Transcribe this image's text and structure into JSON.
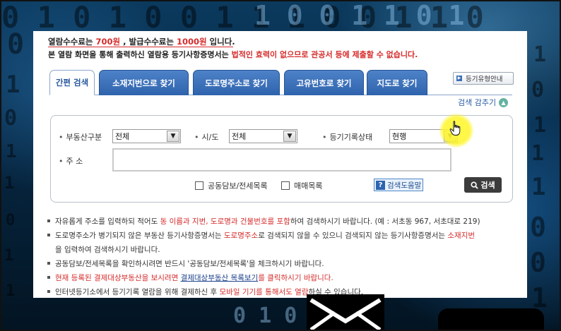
{
  "notice": {
    "fee_prefix": "열람수수료는 ",
    "fee_view": "700원",
    "fee_mid": " , 발급수수료는 ",
    "fee_issue": "1000원",
    "fee_suffix": " 입니다.",
    "legal_prefix": "본 열람 화면을 통해 출력하신 열람용 등기사항증명서는 ",
    "legal_red": "법적인 효력이 없으므로 관공서 등에 제출할 수 없습니다."
  },
  "tabs": [
    {
      "label": "간편 검색",
      "active": true
    },
    {
      "label": "소재지번으로 찾기",
      "active": false
    },
    {
      "label": "도로명주소로 찾기",
      "active": false
    },
    {
      "label": "고유번호로 찾기",
      "active": false
    },
    {
      "label": "지도로 찾기",
      "active": false
    }
  ],
  "type_guide_label": "등기유형안내",
  "hide_search_label": "검색 감추기",
  "search": {
    "property_type_label": "부동산구분",
    "property_type_value": "전체",
    "region_label": "시/도",
    "region_value": "전체",
    "record_status_label": "등기기록상태",
    "record_status_value": "현행",
    "address_label": "주 소",
    "address_value": "",
    "checkbox_mortgage": "공동담보/전세목록",
    "checkbox_sale": "매매목록",
    "help_label": "검색도움말",
    "search_label": "검색"
  },
  "bullets": {
    "b1_a": "자유롭게 주소를 입력하되 적어도 ",
    "b1_red": "동 이름과 지번, 도로명과 건물번호를 포함",
    "b1_b": "하여 검색하시기 바랍니다. (예 : 서초동 967, 서초대로 219)",
    "b2_a": "도로명주소가 병기되지 않은 부동산 등기사항증명서는 ",
    "b2_red1": "도로명주소",
    "b2_b": "로 검색되지 않을 수 있으니 검색되지 않는 등기사항증명서는 ",
    "b2_red2": "소재지번",
    "b2_cont": "을 입력하여 검색하시기 바랍니다.",
    "b3": "공동담보/전세목록을 확인하시려면 반드시 '공동담보/전세목록'을 체크하시기 바랍니다.",
    "b4_red1": "현재 등록된 결제대상부동산을 보시려면 ",
    "b4_link": "결제대상부동산 목록보기",
    "b4_red2": "를 클릭하시기 바랍니다.",
    "b5_a": "인터넷등기소에서 등기기록 열람을 위해 결제하신 후 ",
    "b5_red": "모바일 기기를 통해서도 열람",
    "b5_b": "하실 수 있습니다."
  },
  "colors": {
    "accent_red": "#d62b2b",
    "tab_blue": "#3a6db6",
    "link_blue": "#1a3f8a"
  }
}
